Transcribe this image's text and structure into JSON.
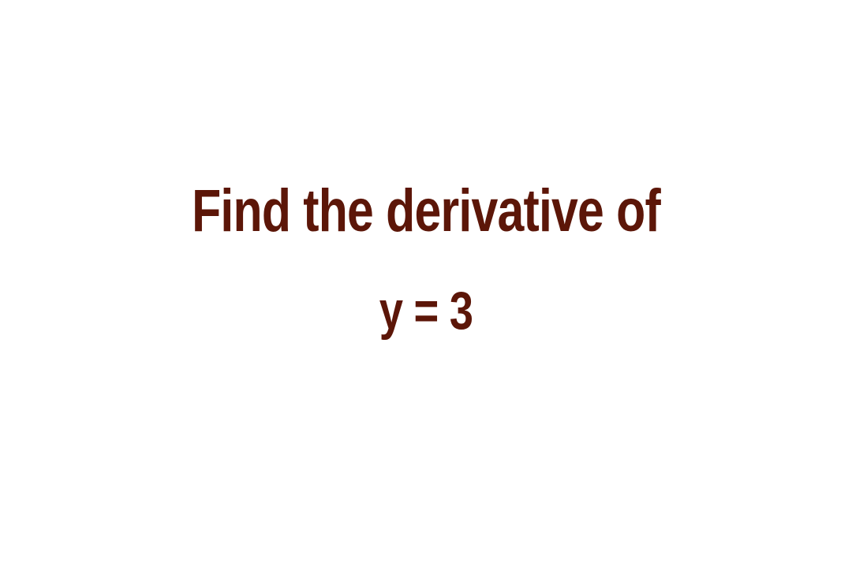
{
  "question": {
    "line1": "Find the derivative of",
    "line2": "y = 3"
  },
  "colors": {
    "text": "#5c1608",
    "background": "#ffffff"
  }
}
